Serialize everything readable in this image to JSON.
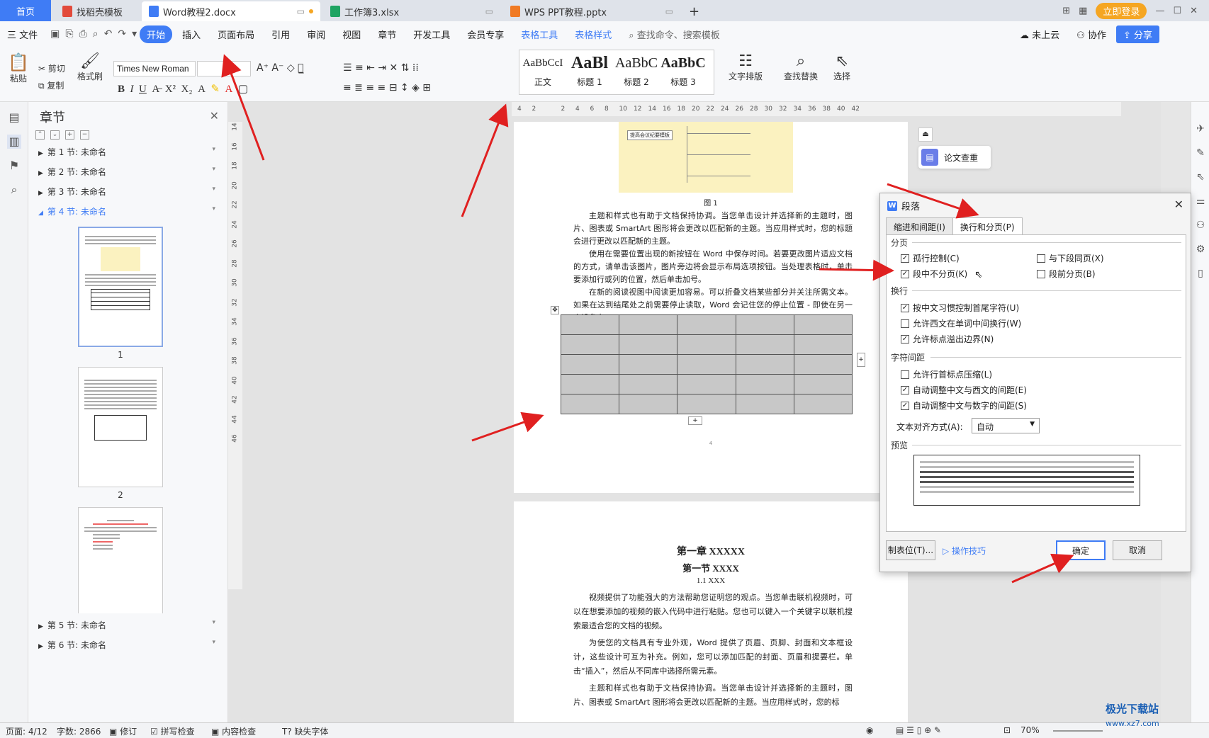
{
  "tabs": {
    "home": "首页",
    "t1": "找稻壳模板",
    "t2": "Word教程2.docx",
    "t3": "工作簿3.xlsx",
    "t4": "WPS PPT教程.pptx",
    "new": "+"
  },
  "topright": {
    "login": "立即登录"
  },
  "menu": {
    "file": "三 文件",
    "items": [
      "开始",
      "插入",
      "页面布局",
      "引用",
      "审阅",
      "视图",
      "章节",
      "开发工具",
      "会员专享"
    ],
    "table_tools": "表格工具",
    "table_style": "表格样式",
    "search": "查找命令、搜索模板",
    "cloud": "未上云",
    "collab": "协作",
    "share": "分享"
  },
  "ribbon": {
    "paste": "粘贴",
    "cut": "剪切",
    "copy": "复制",
    "format_painter": "格式刷",
    "font": "Times New Roman",
    "styles": [
      {
        "sample": "AaBbCcI",
        "name": "正文"
      },
      {
        "sample": "AaBl",
        "name": "标题 1"
      },
      {
        "sample": "AaBbC",
        "name": "标题 2"
      },
      {
        "sample": "AaBbC",
        "name": "标题 3"
      }
    ],
    "text_layout": "文字排版",
    "find_replace": "查找替换",
    "select": "选择"
  },
  "nav": {
    "title": "章节",
    "sections": [
      "第 1 节: 未命名",
      "第 2 节: 未命名",
      "第 3 节: 未命名",
      "第 4 节: 未命名",
      "第 5 节: 未命名",
      "第 6 节: 未命名"
    ],
    "thumb_labels": [
      "1",
      "2"
    ]
  },
  "ruler": {
    "h": [
      "4",
      "2",
      "",
      "2",
      "4",
      "6",
      "8",
      "10",
      "12",
      "14",
      "16",
      "18",
      "20",
      "22",
      "24",
      "26",
      "28",
      "30",
      "32",
      "34",
      "36",
      "38",
      "40",
      "42"
    ],
    "v": [
      "14",
      "16",
      "18",
      "20",
      "22",
      "24",
      "26",
      "28",
      "30",
      "32",
      "34",
      "36",
      "38",
      "40",
      "42",
      "44",
      "46"
    ]
  },
  "page1": {
    "caption": "图 1",
    "p1": "主题和样式也有助于文档保持协调。当您单击设计并选择新的主题时，图片、图表或 SmartArt 图形将会更改以匹配新的主题。当应用样式时，您的标题会进行更改以匹配新的主题。",
    "p2": "使用在需要位置出现的新按钮在 Word 中保存时间。若要更改图片适应文档的方式，请单击该图片，图片旁边将会显示布局选项按钮。当处理表格时，单击要添加行或列的位置，然后单击加号。",
    "p3": "在新的阅读视图中阅读更加容易。可以折叠文档某些部分并关注所需文本。如果在达到结尾处之前需要停止读取，Word 会记住您的停止位置 - 即使在另一个设备上。",
    "page_num": "4"
  },
  "page2": {
    "h1": "第一章 XXXXX",
    "h2": "第一节 XXXX",
    "h3": "1.1 XXX",
    "p1": "视频提供了功能强大的方法帮助您证明您的观点。当您单击联机视频时，可以在想要添加的视频的嵌入代码中进行粘贴。您也可以键入一个关键字以联机搜索最适合您的文档的视频。",
    "p2": "为使您的文档具有专业外观，Word 提供了页眉、页脚、封面和文本框设计，这些设计可互为补充。例如，您可以添加匹配的封面、页眉和提要栏。单击“插入”，然后从不同库中选择所需元素。",
    "p3": "主题和样式也有助于文档保持协调。当您单击设计并选择新的主题时，图片、图表或 SmartArt 图形将会更改以匹配新的主题。当应用样式时，您的标"
  },
  "mindmap": {
    "root": "提高会议纪要模板"
  },
  "side_panel": {
    "paper_check": "论文查重"
  },
  "dialog": {
    "title": "段落",
    "tab1": "缩进和间距(I)",
    "tab2": "换行和分页(P)",
    "g1": "分页",
    "widow": "孤行控制(C)",
    "keep_next": "与下段同页(X)",
    "keep_lines": "段中不分页(K)",
    "page_before": "段前分页(B)",
    "g2": "换行",
    "cn_rule": "按中文习惯控制首尾字符(U)",
    "break_word": "允许西文在单词中间换行(W)",
    "hang_punct": "允许标点溢出边界(N)",
    "g3": "字符间距",
    "compress": "允许行首标点压缩(L)",
    "auto_en": "自动调整中文与西文的间距(E)",
    "auto_num": "自动调整中文与数字的间距(S)",
    "align_label": "文本对齐方式(A):",
    "align_val": "自动",
    "preview": "预览",
    "tabs_btn": "制表位(T)...",
    "tips": "操作技巧",
    "ok": "确定",
    "cancel": "取消"
  },
  "status": {
    "page": "页面: 4/12",
    "words": "字数: 2866",
    "revise": "修订",
    "spell": "拼写检查",
    "content": "内容检查",
    "missing_font": "缺失字体",
    "zoom": "70%"
  },
  "watermark": "极光下载站",
  "watermark_url": "www.xz7.com",
  "colors": {
    "accent": "#3f7cf5",
    "arrow": "#e02020"
  }
}
